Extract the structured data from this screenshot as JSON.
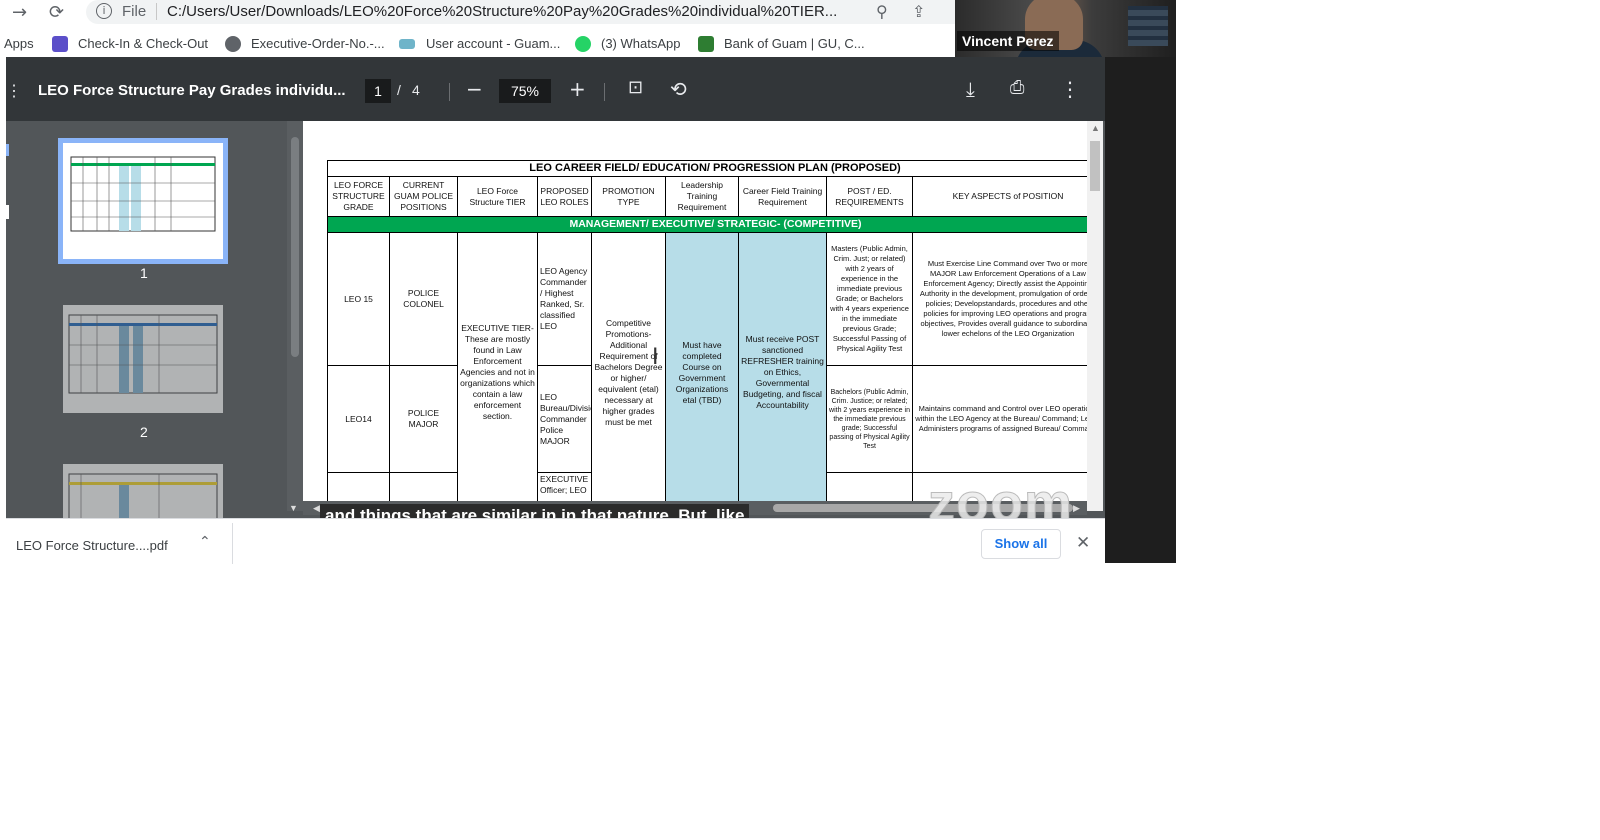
{
  "browser": {
    "scheme": "File",
    "url": "C:/Users/User/Downloads/LEO%20Force%20Structure%20Pay%20Grades%20individual%20TIER...",
    "bookmarks": [
      {
        "label": "Apps"
      },
      {
        "label": "Check-In & Check-Out"
      },
      {
        "label": "Executive-Order-No.-..."
      },
      {
        "label": "User account - Guam..."
      },
      {
        "label": "(3) WhatsApp"
      },
      {
        "label": "Bank of Guam | GU, C..."
      }
    ],
    "icon_names": [
      "back-arrow-icon",
      "reload-icon",
      "info-icon",
      "zoom-icon",
      "share-icon"
    ]
  },
  "video": {
    "participant_name": "Vincent Perez"
  },
  "viewer": {
    "title": "LEO Force Structure Pay Grades individu...",
    "page_current": "1",
    "page_separator": "/",
    "page_total": "4",
    "zoom": "75%",
    "thumb_labels": [
      "1",
      "2"
    ]
  },
  "document": {
    "title": "LEO CAREER FIELD/ EDUCATION/ PROGRESSION PLAN (PROPOSED)",
    "headers": [
      "LEO FORCE STRUCTURE GRADE",
      "CURRENT GUAM POLICE POSITIONS",
      "LEO Force Structure TIER",
      "PROPOSED LEO ROLES",
      "PROMOTION TYPE",
      "Leadership Training Requirement",
      "Career Field Training Requirement",
      "POST / ED. REQUIREMENTS",
      "KEY ASPECTS of POSITION"
    ],
    "band": "MANAGEMENT/ EXECUTIVE/ STRATEGIC- (COMPETITIVE)",
    "rows": [
      {
        "grade": "LEO 15",
        "position": "POLICE COLONEL",
        "role": "LEO Agency Commander / Highest Ranked, Sr. classified LEO",
        "post_ed": "Masters (Public Admin, Crim. Just; or related) with 2 years of experience in the immediate previous Grade; or Bachelors with 4 years experience in the immediate previous Grade; Successful Passing of Physical Agility Test",
        "key": "Must Exercise Line Command over Two or more MAJOR Law Enforcement Operations of a Law Enforcement Agency; Directly assist the Appointing Authority in the development, promulgation of orders, policies; Developstandards, procedures and other policies for improving LEO operations and program objectives, Provides overall guidance to subordinate/ lower echelons of the LEO Organization"
      },
      {
        "grade": "LEO14",
        "position": "POLICE MAJOR",
        "role": "LEO Bureau/Division Commander Police MAJOR",
        "post_ed": "Bachelors (Public Admin, Crim. Justice; or related; with 2 years experience in the immediate previous grade; Successful passing of Physical Agility Test",
        "key": "Maintains command and Control over LEO operations within the LEO Agency at the Bureau/ Command; Level; Administers programs of assigned Bureau/ Command"
      },
      {
        "role": "EXECUTIVE Officer; LEO"
      }
    ],
    "tier": "EXECUTIVE TIER- These are mostly found in Law Enforcement Agencies and not in organizations which contain a law enforcement section.",
    "promotion": "Competitive Promotions- Additional Requirement of Bachelors Degree or higher/ equivalent (etal) necessary at higher grades must be met",
    "leadership": "Must have completed Course on Government Organizations etal (TBD)",
    "career": "Must receive POST sanctioned REFRESHER training on Ethics, Governmental Budgeting, and fiscal Accountability"
  },
  "caption": "and things that are similar in in that nature. But, like",
  "zoom_watermark": "zoom",
  "downloads": {
    "file_label": "LEO Force Structure....pdf",
    "show_all": "Show all"
  },
  "colors": {
    "toolbar": "#323639",
    "viewer_bg": "#525659",
    "band_green": "#00a651",
    "column_blue": "#b7dde8",
    "link_blue": "#1a73e8"
  }
}
